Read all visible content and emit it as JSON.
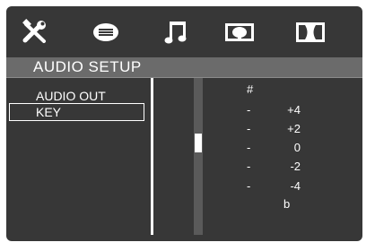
{
  "tabs": [
    {
      "name": "general-setup",
      "icon": "tools-icon"
    },
    {
      "name": "speaker-setup",
      "icon": "speaker-icon"
    },
    {
      "name": "audio-setup",
      "icon": "music-note-icon"
    },
    {
      "name": "video-setup",
      "icon": "video-icon"
    },
    {
      "name": "dolby-setup",
      "icon": "dolby-icon"
    }
  ],
  "title": "AUDIO SETUP",
  "menu": {
    "items": [
      "AUDIO OUT",
      "KEY"
    ],
    "selected": "KEY"
  },
  "key_options": {
    "top": "#",
    "rows": [
      {
        "dash": "-",
        "value": "+4"
      },
      {
        "dash": "-",
        "value": "+2"
      },
      {
        "dash": "-",
        "value": "0"
      },
      {
        "dash": "-",
        "value": "-2"
      },
      {
        "dash": "-",
        "value": "-4"
      }
    ],
    "bottom": "b"
  },
  "slider": {
    "level": 0.5
  },
  "colors": {
    "panel": "#373737",
    "title_bar": "#6b6b6b",
    "text": "#ffffff"
  }
}
